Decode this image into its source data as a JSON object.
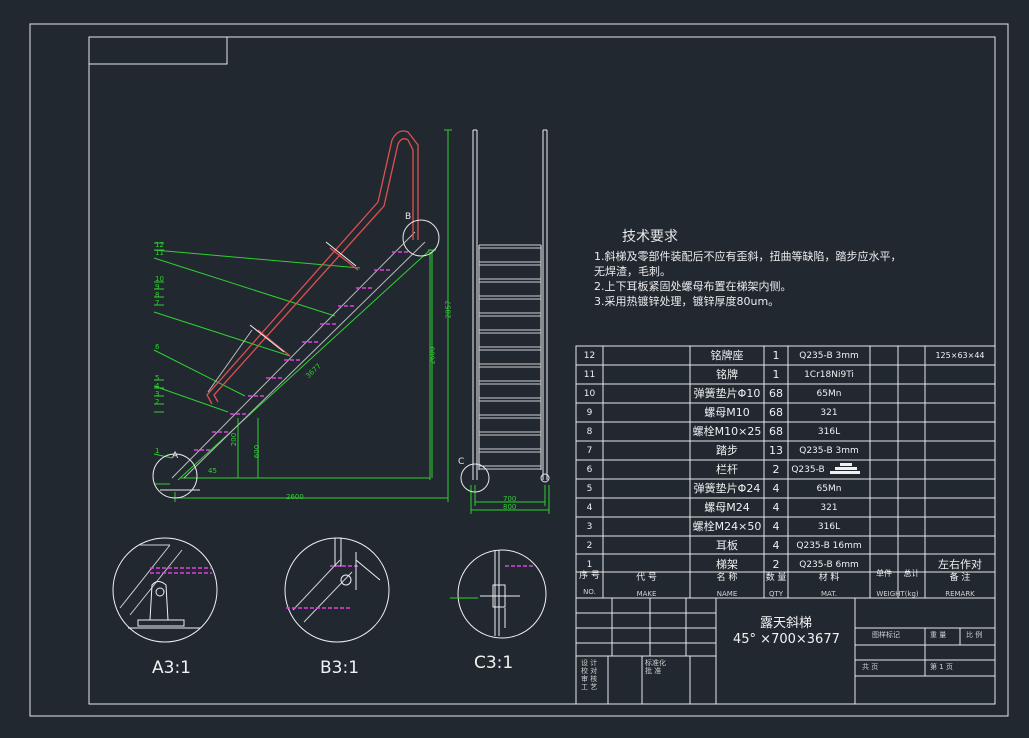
{
  "tech_requirements": {
    "title": "技术要求",
    "lines": [
      "1.斜梯及零部件装配后不应有歪斜，扭曲等缺陷，踏步应水平，",
      "无焊渣，毛刺。",
      "2.上下耳板紧固处螺母布置在梯架内侧。",
      "3.采用热镀锌处理，镀锌厚度80um。"
    ]
  },
  "dimensions": {
    "d2600": "2600",
    "d3677": "3677",
    "d2600v": "2600",
    "d2857": "2857",
    "d600": "600",
    "d700": "700",
    "d800": "800",
    "d200": "200",
    "d45": "45"
  },
  "callouts": [
    "12",
    "11",
    "10",
    "9",
    "8",
    "7",
    "6",
    "5",
    "4",
    "3",
    "2",
    "1"
  ],
  "view_marks": {
    "a": "A",
    "b": "B",
    "c": "C"
  },
  "details": [
    {
      "label": "A3:1"
    },
    {
      "label": "B3:1"
    },
    {
      "label": "C3:1"
    }
  ],
  "bom": {
    "rows": [
      {
        "no": "12",
        "name": "铭牌座",
        "qty": "1",
        "mat": "Q235-B 3mm",
        "note": "125×63×44"
      },
      {
        "no": "11",
        "name": "铭牌",
        "qty": "1",
        "mat": "1Cr18Ni9Ti",
        "note": ""
      },
      {
        "no": "10",
        "name": "弹簧垫片Φ10",
        "qty": "68",
        "mat": "65Mn",
        "note": ""
      },
      {
        "no": "9",
        "name": "螺母M10",
        "qty": "68",
        "mat": "321",
        "note": ""
      },
      {
        "no": "8",
        "name": "螺栓M10×25",
        "qty": "68",
        "mat": "316L",
        "note": ""
      },
      {
        "no": "7",
        "name": "踏步",
        "qty": "13",
        "mat": "Q235-B 3mm",
        "note": ""
      },
      {
        "no": "6",
        "name": "栏杆",
        "qty": "2",
        "mat": "Q235-B",
        "note": ""
      },
      {
        "no": "5",
        "name": "弹簧垫片Φ24",
        "qty": "4",
        "mat": "65Mn",
        "note": ""
      },
      {
        "no": "4",
        "name": "螺母M24",
        "qty": "4",
        "mat": "321",
        "note": ""
      },
      {
        "no": "3",
        "name": "螺栓M24×50",
        "qty": "4",
        "mat": "316L",
        "note": ""
      },
      {
        "no": "2",
        "name": "耳板",
        "qty": "4",
        "mat": "Q235-B 16mm",
        "note": ""
      },
      {
        "no": "1",
        "name": "梯架",
        "qty": "2",
        "mat": "Q235-B 6mm",
        "note": "左右作对"
      }
    ],
    "header": {
      "no": "序 号",
      "no_en": "NO.",
      "code": "代 号",
      "code_en": "MAKE",
      "name": "名 称",
      "name_en": "NAME",
      "qty": "数 量",
      "qty_en": "QTY",
      "mat": "材 料",
      "mat_en": "MAT.",
      "unit": "单件",
      "total": "总计",
      "weight_en": "WEIGHT(kg)",
      "remark": "备 注",
      "remark_en": "REMARK"
    }
  },
  "title_block": {
    "title": "露天斜梯",
    "subtitle": "45° ×700×3677",
    "labels": [
      "图样标记",
      "重 量",
      "比 例",
      "共 页",
      "第 1 页"
    ],
    "sign_labels": [
      "设 计",
      "校 对",
      "审 核",
      "工 艺",
      "标准化",
      "批 准"
    ]
  }
}
